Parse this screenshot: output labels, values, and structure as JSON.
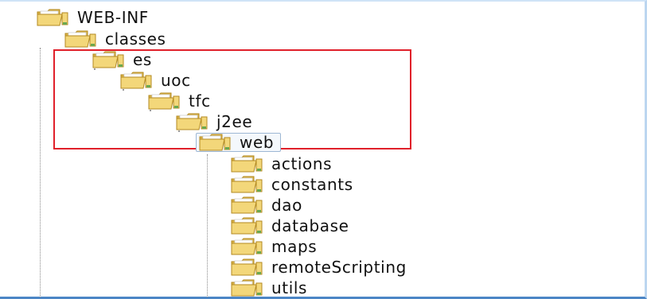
{
  "tree": {
    "root": {
      "label": "WEB-INF",
      "icon": "folder-icon"
    },
    "classes": {
      "label": "classes",
      "icon": "folder-icon"
    },
    "es": {
      "label": "es",
      "icon": "folder-icon"
    },
    "uoc": {
      "label": "uoc",
      "icon": "folder-icon"
    },
    "tfc": {
      "label": "tfc",
      "icon": "folder-icon"
    },
    "j2ee": {
      "label": "j2ee",
      "icon": "folder-icon"
    },
    "web": {
      "label": "web",
      "icon": "folder-icon",
      "selected": true
    },
    "children": [
      {
        "label": "actions",
        "icon": "folder-icon"
      },
      {
        "label": "constants",
        "icon": "folder-icon"
      },
      {
        "label": "dao",
        "icon": "folder-icon"
      },
      {
        "label": "database",
        "icon": "folder-icon"
      },
      {
        "label": "maps",
        "icon": "folder-icon"
      },
      {
        "label": "remoteScripting",
        "icon": "folder-icon"
      },
      {
        "label": "utils",
        "icon": "folder-icon"
      }
    ]
  },
  "highlight": {
    "color": "#e0202a"
  },
  "colors": {
    "folder_front": "#f3d77a",
    "folder_back": "#d9b347",
    "folder_paper": "#ffffff",
    "folder_outline": "#b38a22"
  }
}
